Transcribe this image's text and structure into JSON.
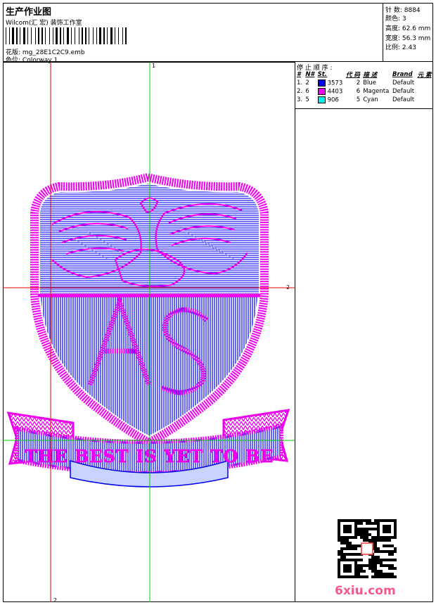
{
  "header": {
    "title": "生产作业图",
    "company": "Wilcom(汇 宏) 装饰工作室",
    "design_label": "花版: ",
    "design_file": "mg_28E1C2C9.emb",
    "colorway_label": "色位: ",
    "colorway": "Colorway 1"
  },
  "stats": {
    "stitches": "针 数: 8884",
    "colors": "颜色: 3",
    "height": "高度: 62.6 mm",
    "width": "宽度: 56.3 mm",
    "scale": "比例: 2.43"
  },
  "canvas": {
    "guide_labels": [
      "1",
      "2",
      "2"
    ]
  },
  "sequence": {
    "title": "停 止 顺 序 :",
    "headers": [
      "#",
      "N#",
      "St.",
      "代 码",
      "描 述",
      "Brand",
      "元 素"
    ],
    "rows": [
      {
        "idx": "1.",
        "needle": "2",
        "color": "#0000ee",
        "stitches": "3573",
        "code": "2",
        "desc": "Blue",
        "brand": "Default"
      },
      {
        "idx": "2.",
        "needle": "6",
        "color": "#ee00ee",
        "stitches": "4403",
        "code": "6",
        "desc": "Magenta",
        "brand": "Default"
      },
      {
        "idx": "3.",
        "needle": "5",
        "color": "#00eeee",
        "stitches": "906",
        "code": "5",
        "desc": "Cyan",
        "brand": "Default"
      }
    ]
  },
  "badge": {
    "banner_text": "THE BEST IS YET TO BE",
    "monogram": "AS"
  },
  "watermark": {
    "site": "6xiu.com"
  }
}
